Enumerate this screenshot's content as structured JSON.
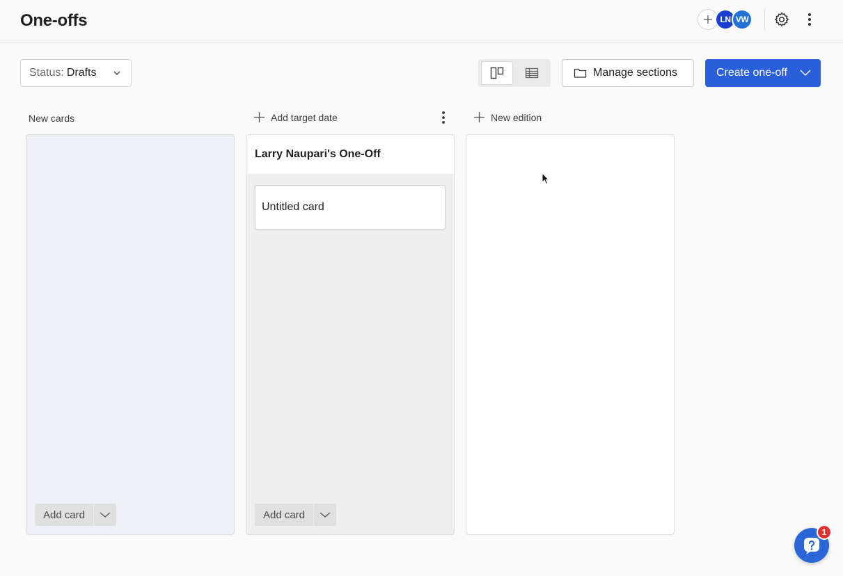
{
  "header": {
    "title": "One-offs",
    "avatars": [
      {
        "initials": "LN",
        "color": "#1a3fcf"
      },
      {
        "initials": "VW",
        "color": "#2373d6"
      }
    ]
  },
  "toolbar": {
    "status_label": "Status:",
    "status_value": "Drafts",
    "manage_sections_label": "Manage sections",
    "create_label": "Create one-off",
    "views": [
      "board-view-icon",
      "table-view-icon"
    ],
    "active_view": "board"
  },
  "columns": {
    "new_cards": {
      "title": "New cards",
      "add_card_label": "Add card"
    },
    "edition": {
      "add_target_date_label": "Add target date",
      "title": "Larry Naupari's One-Off",
      "cards": [
        "Untitled card"
      ],
      "add_card_label": "Add card"
    },
    "new_edition_label": "New edition"
  },
  "help": {
    "badge_count": "1"
  },
  "colors": {
    "primary": "#2b5fd9",
    "badge": "#e03131"
  }
}
